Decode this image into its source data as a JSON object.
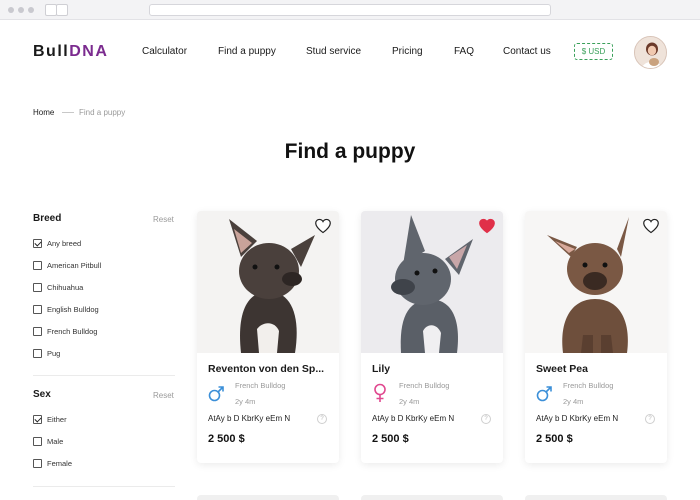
{
  "header": {
    "logo_main": "Bull",
    "logo_accent": "DNA",
    "nav": [
      "Calculator",
      "Find a puppy",
      "Stud service",
      "Pricing",
      "FAQ",
      "Contact us"
    ],
    "currency": "$ USD"
  },
  "breadcrumb": {
    "home": "Home",
    "current": "Find a puppy"
  },
  "page_title": "Find a puppy",
  "filters": {
    "breed": {
      "title": "Breed",
      "reset": "Reset",
      "options": [
        {
          "label": "Any breed",
          "checked": true
        },
        {
          "label": "American Pitbull",
          "checked": false
        },
        {
          "label": "Chihuahua",
          "checked": false
        },
        {
          "label": "English Bulldog",
          "checked": false
        },
        {
          "label": "French Bulldog",
          "checked": false
        },
        {
          "label": "Pug",
          "checked": false
        }
      ]
    },
    "sex": {
      "title": "Sex",
      "reset": "Reset",
      "options": [
        {
          "label": "Either",
          "checked": true
        },
        {
          "label": "Male",
          "checked": false
        },
        {
          "label": "Female",
          "checked": false
        }
      ]
    }
  },
  "cards": [
    {
      "name": "Reventon von den Sp...",
      "breed": "French Bulldog",
      "age": "2y 4m",
      "genotype": "AtAy b D KbrKy eEm N",
      "price": "2 500 $",
      "sex": "male",
      "favorite": false
    },
    {
      "name": "Lily",
      "breed": "French Bulldog",
      "age": "2y 4m",
      "genotype": "AtAy b D KbrKy eEm N",
      "price": "2 500 $",
      "sex": "female",
      "favorite": true
    },
    {
      "name": "Sweet Pea",
      "breed": "French Bulldog",
      "age": "2y 4m",
      "genotype": "AtAy b D KbrKy eEm N",
      "price": "2 500 $",
      "sex": "male",
      "favorite": false
    }
  ],
  "card_help": "?",
  "colors": {
    "accent": "#7b2b8f",
    "male": "#3b8fd8",
    "female": "#e0488f",
    "heart_active": "#e03049",
    "currency": "#3aa05a"
  }
}
